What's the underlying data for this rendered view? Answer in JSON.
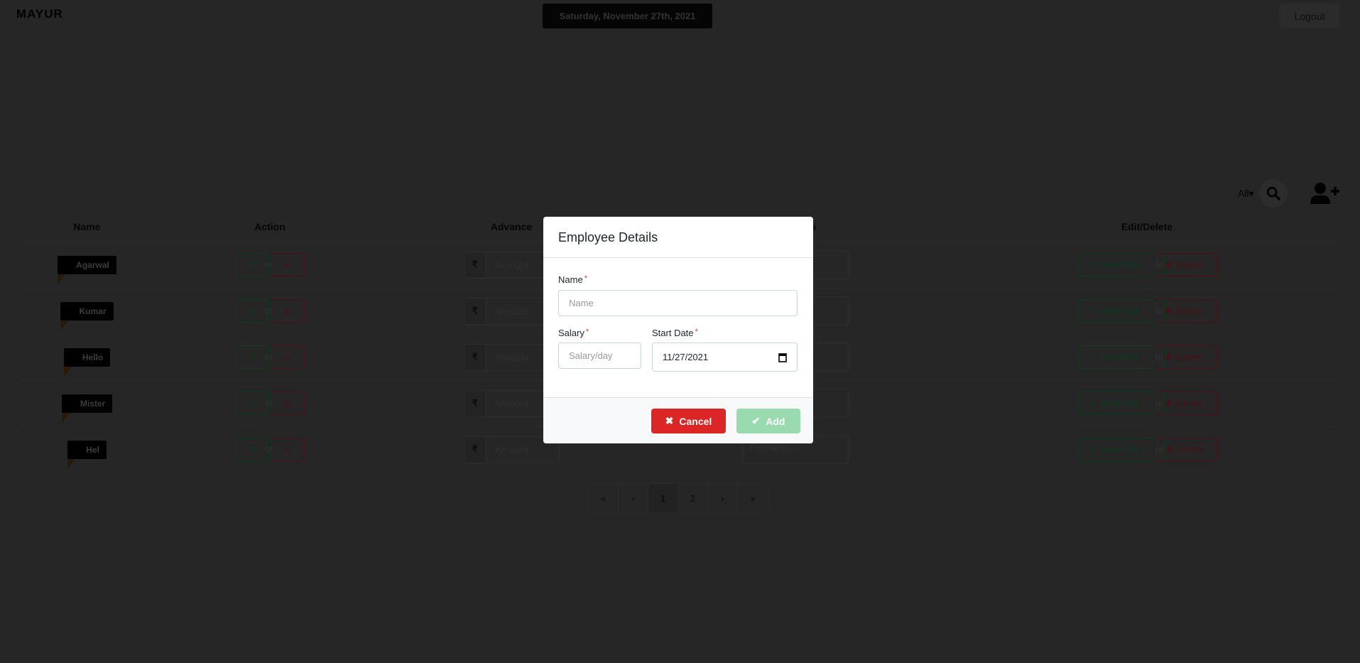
{
  "header": {
    "brand": "MAYUR",
    "date": "Saturday, November 27th, 2021",
    "logout": "Logout"
  },
  "toolbar": {
    "filter": "All",
    "filter_caret": "▾"
  },
  "table": {
    "headers": [
      "Name",
      "Action",
      "Advance",
      "Remarks",
      "Edit/Delete"
    ],
    "rows": [
      {
        "name": "Agarwal"
      },
      {
        "name": "Kumar"
      },
      {
        "name": "Hello"
      },
      {
        "name": "Mister"
      },
      {
        "name": "Hel"
      }
    ],
    "present": "P",
    "or": "or",
    "absent": "A",
    "currency": "₹",
    "amount_placeholder": "Amount",
    "remarks_placeholder": "Remarks...",
    "view_edit": "View/Edit",
    "delete": "Delete"
  },
  "pagination": {
    "first": "«",
    "prev": "‹",
    "pages": [
      "1",
      "2"
    ],
    "next": "›",
    "last": "»",
    "current": "1"
  },
  "modal": {
    "title": "Employee Details",
    "name_label": "Name",
    "name_placeholder": "Name",
    "salary_label": "Salary",
    "salary_placeholder": "Salary/day",
    "start_date_label": "Start Date",
    "start_date_value": "11/27/2021",
    "required_mark": "*",
    "cancel": "Cancel",
    "add": "Add"
  },
  "colors": {
    "cancel": "#dc2626",
    "add": "#99dbae",
    "present": "#198754",
    "absent": "#dc3545"
  }
}
